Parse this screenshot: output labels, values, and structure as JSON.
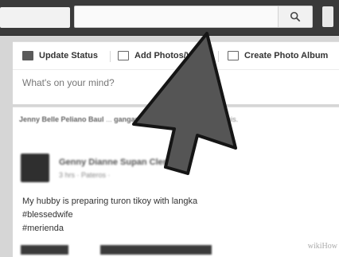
{
  "search": {
    "value": "",
    "icon": "search-icon"
  },
  "composer": {
    "actions": [
      {
        "label": "Update Status",
        "icon": "pencil-icon"
      },
      {
        "label": "Add Photos/V",
        "icon": "photo-icon"
      },
      {
        "label": "Create Photo Album",
        "icon": "album-icon"
      }
    ],
    "placeholder": "What's on your mind?"
  },
  "feed": {
    "notice_actor": "Jenny Belle Peliano Baul",
    "notice_target": "gangan Clemente",
    "notice_text": "commented on this.",
    "post": {
      "author": "Genny Dianne Supan Clemente",
      "meta": "3 hrs · Pateros ·",
      "lines": [
        "My hubby is preparing turon tikoy with langka",
        "#blessedwife",
        "#merienda"
      ]
    }
  },
  "watermark": "wikiHow"
}
